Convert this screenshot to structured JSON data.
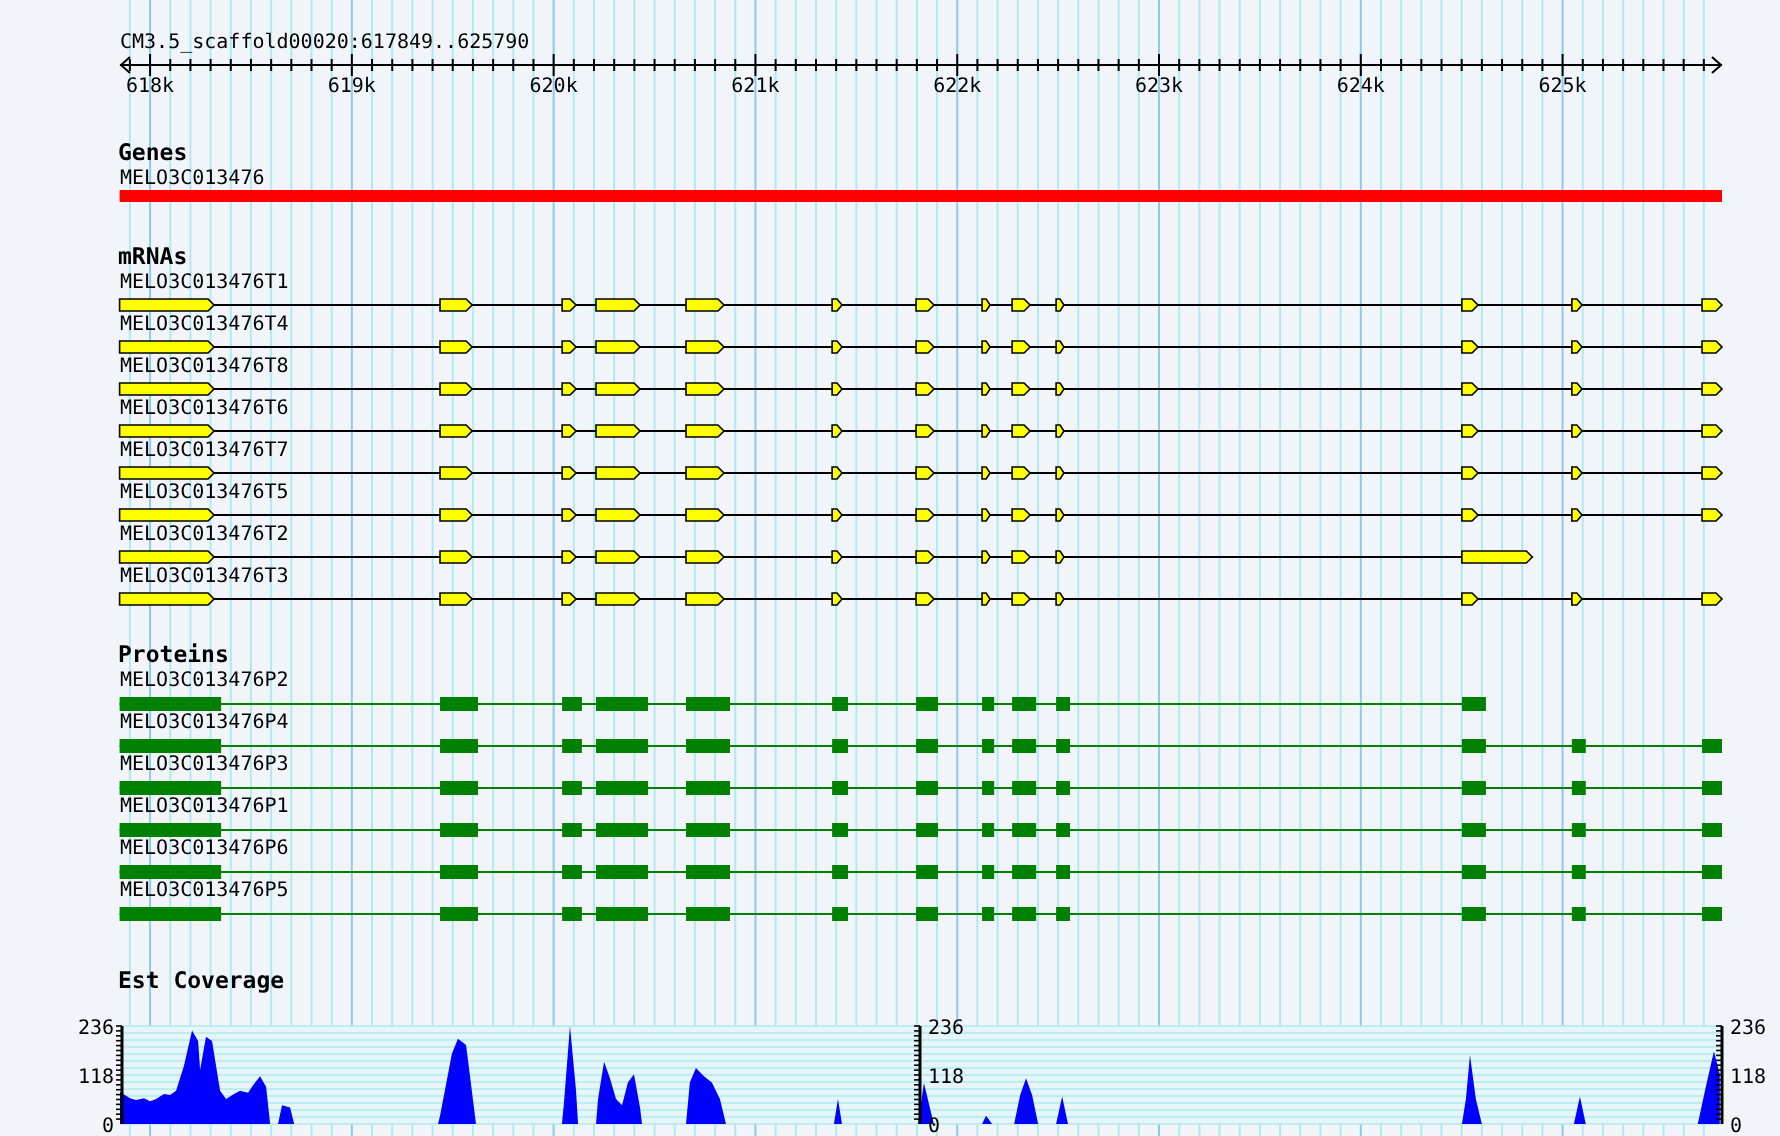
{
  "region": {
    "label": "CM3.5_scaffold00020:617849..625790"
  },
  "ruler": {
    "ticks": [
      "618k",
      "619k",
      "620k",
      "621k",
      "622k",
      "623k",
      "624k",
      "625k"
    ]
  },
  "tracks": [
    {
      "kind": "genes",
      "title": "Genes",
      "features": [
        {
          "name": "MELO3C013476",
          "kind": "full"
        }
      ]
    },
    {
      "kind": "mrna",
      "title": "mRNAs",
      "features": [
        {
          "name": "MELO3C013476T1",
          "kind": "full"
        },
        {
          "name": "MELO3C013476T4",
          "kind": "full"
        },
        {
          "name": "MELO3C013476T8",
          "kind": "full"
        },
        {
          "name": "MELO3C013476T6",
          "kind": "full"
        },
        {
          "name": "MELO3C013476T7",
          "kind": "full"
        },
        {
          "name": "MELO3C013476T5",
          "kind": "full"
        },
        {
          "name": "MELO3C013476T2",
          "kind": "short"
        },
        {
          "name": "MELO3C013476T3",
          "kind": "full"
        }
      ]
    },
    {
      "kind": "protein",
      "title": "Proteins",
      "features": [
        {
          "name": "MELO3C013476P2",
          "kind": "short"
        },
        {
          "name": "MELO3C013476P4",
          "kind": "full"
        },
        {
          "name": "MELO3C013476P3",
          "kind": "full"
        },
        {
          "name": "MELO3C013476P1",
          "kind": "full"
        },
        {
          "name": "MELO3C013476P6",
          "kind": "full"
        },
        {
          "name": "MELO3C013476P5",
          "kind": "full"
        }
      ]
    },
    {
      "kind": "coverage",
      "title": "Est Coverage",
      "axes": [
        {
          "labels": [
            "236",
            "118",
            "0"
          ]
        },
        {
          "labels": [
            "236",
            "118",
            "0"
          ]
        },
        {
          "labels": [
            "236",
            "118",
            "0"
          ]
        }
      ]
    }
  ]
}
